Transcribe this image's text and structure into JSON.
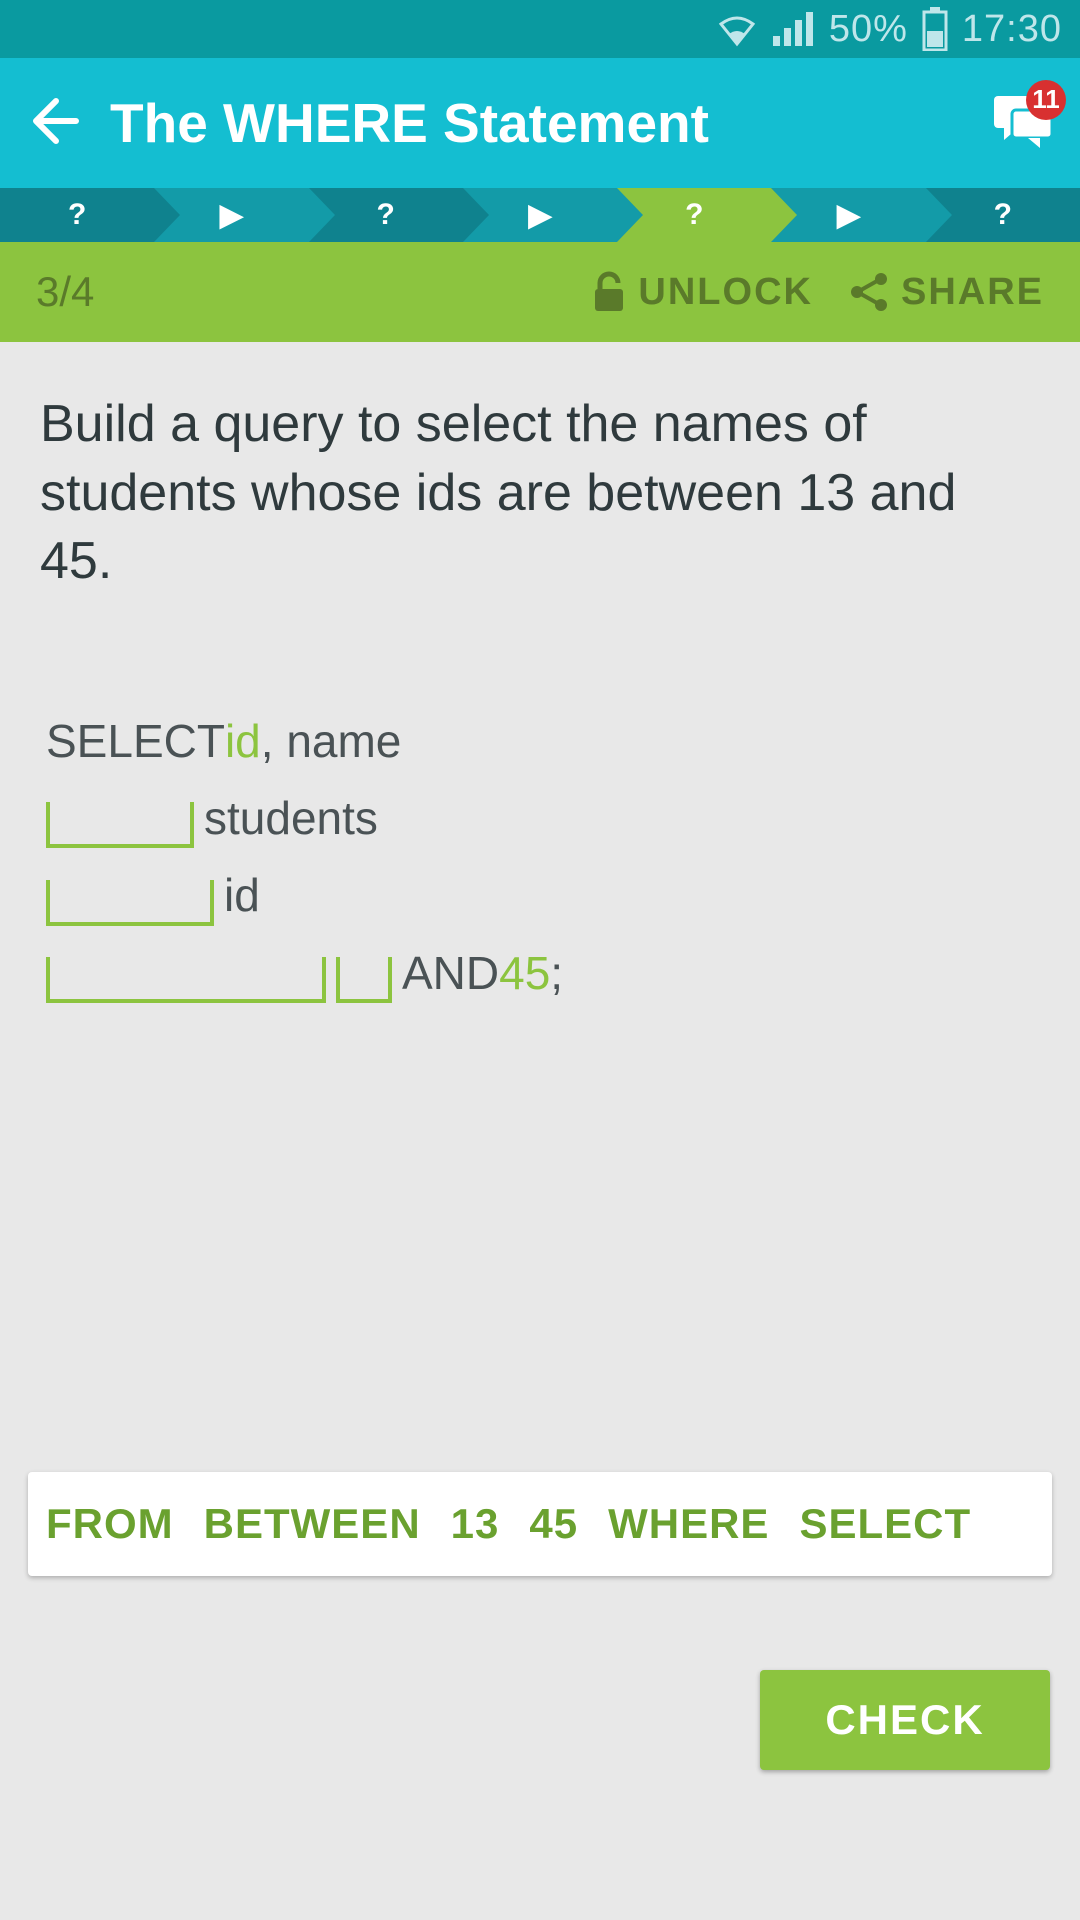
{
  "status": {
    "battery": "50%",
    "time": "17:30"
  },
  "header": {
    "title": "The WHERE Statement",
    "notification_count": "11"
  },
  "chevrons": [
    "?",
    "▶",
    "?",
    "▶",
    "?",
    "▶",
    "?"
  ],
  "subbar": {
    "counter": "3/4",
    "unlock": "UNLOCK",
    "share": "SHARE"
  },
  "question": "Build a query to select the names of students whose ids are between 13 and 45.",
  "code": {
    "line1_kw": "SELECT ",
    "line1_fill": "id",
    "line1_rest": ", name",
    "line2_rest": " students",
    "line3_rest": " id",
    "line4_and": " AND ",
    "line4_fill": "45",
    "line4_semi": ";"
  },
  "word_bank": [
    "FROM",
    "BETWEEN",
    "13",
    "45",
    "WHERE",
    "SELECT"
  ],
  "check_label": "CHECK"
}
